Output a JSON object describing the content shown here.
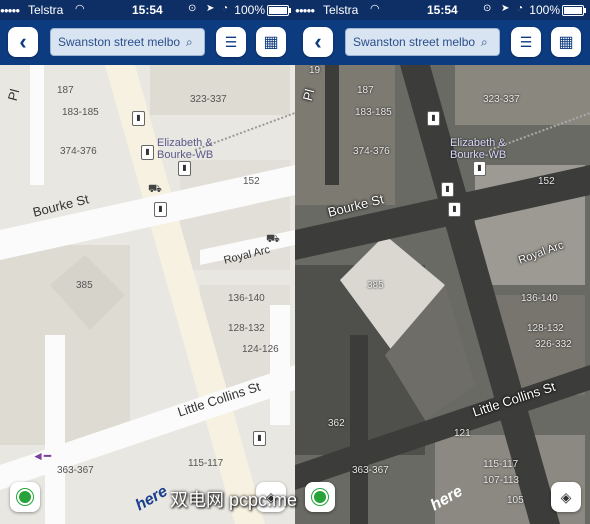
{
  "status": {
    "carrier": "Telstra",
    "time": "15:54",
    "battery_percent": "100%"
  },
  "toolbar": {
    "back_label": "‹",
    "search_value": "Swanston street melbo",
    "list_icon": "☰",
    "grid_icon": "▦"
  },
  "map": {
    "streets": {
      "bourke": "Bourke St",
      "little_collins": "Little Collins St",
      "royal_arc": "Royal Arc",
      "top_left": "Pl"
    },
    "poi": {
      "station_line1": "Elizabeth &",
      "station_line2": "Bourke-WB"
    },
    "numbers_left": [
      "187",
      "183-185",
      "374-376",
      "152",
      "385",
      "136-140",
      "128-132",
      "124-126",
      "363-367",
      "115-117",
      "323-337"
    ],
    "numbers_right": [
      "19",
      "187",
      "183-185",
      "374-376",
      "152",
      "385",
      "136-140",
      "128-132",
      "326-332",
      "362",
      "121",
      "363-367",
      "115-117",
      "107-113",
      "105",
      "323-337"
    ]
  },
  "brand": "here",
  "watermark": "双电网 pcpc.me",
  "colors": {
    "topbar": "#0d3b80",
    "statusbar": "#0d2f66",
    "location_green": "#27a33a"
  }
}
